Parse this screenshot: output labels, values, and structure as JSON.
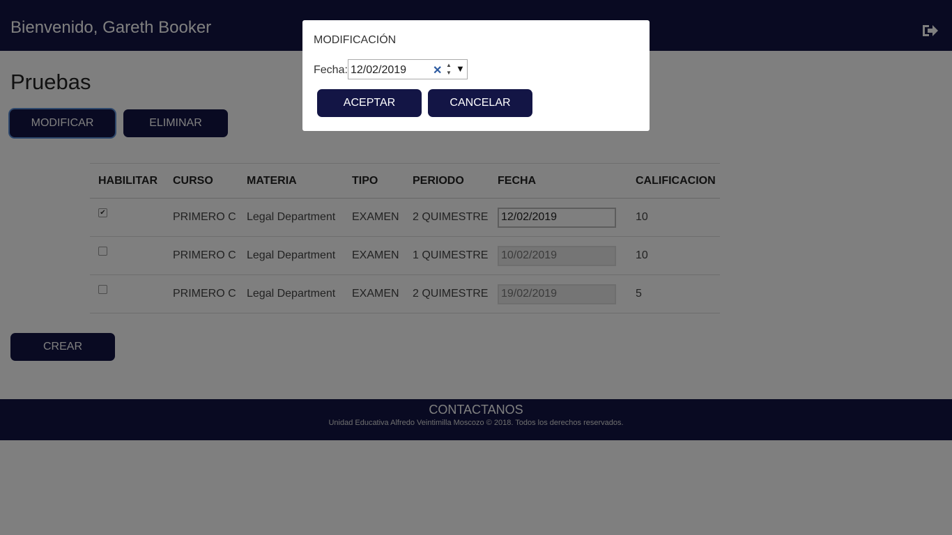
{
  "header": {
    "welcome": "Bienvenido, Gareth Booker",
    "logout_icon": "logout-icon"
  },
  "page": {
    "title": "Pruebas",
    "modificar_label": "MODIFICAR",
    "eliminar_label": "ELIMINAR",
    "crear_label": "CREAR"
  },
  "table": {
    "columns": [
      "HABILITAR",
      "CURSO",
      "MATERIA",
      "TIPO",
      "PERIODO",
      "FECHA",
      "CALIFICACION"
    ],
    "rows": [
      {
        "checked": true,
        "curso": "PRIMERO C",
        "materia": "Legal Department",
        "tipo": "EXAMEN",
        "periodo": "2 QUIMESTRE",
        "fecha": "12/02/2019",
        "calificacion": "10"
      },
      {
        "checked": false,
        "curso": "PRIMERO C",
        "materia": "Legal Department",
        "tipo": "EXAMEN",
        "periodo": "1 QUIMESTRE",
        "fecha": "10/02/2019",
        "calificacion": "10"
      },
      {
        "checked": false,
        "curso": "PRIMERO C",
        "materia": "Legal Department",
        "tipo": "EXAMEN",
        "periodo": "2 QUIMESTRE",
        "fecha": "19/02/2019",
        "calificacion": "5"
      }
    ]
  },
  "footer": {
    "title": "CONTACTANOS",
    "copyright": "Unidad Educativa Alfredo Veintimilla Moscozo © 2018. Todos los derechos reservados."
  },
  "modal": {
    "title": "MODIFICACIÓN",
    "fecha_label": "Fecha:",
    "fecha_value": "12/02/2019",
    "aceptar_label": "ACEPTAR",
    "cancelar_label": "CANCELAR"
  },
  "colors": {
    "brand": "#131545",
    "focus": "#5b8fd6"
  }
}
